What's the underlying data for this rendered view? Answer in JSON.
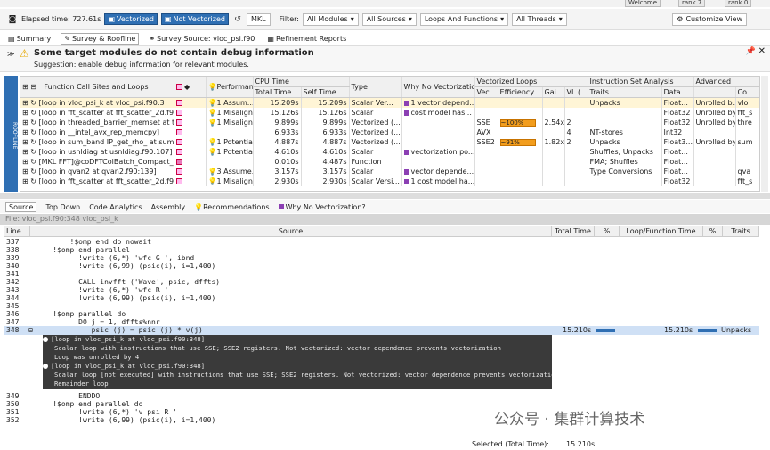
{
  "window_tabs": [
    "Welcome",
    "rank.7",
    "rank.0"
  ],
  "toolbar": {
    "elapsed": "Elapsed time: 727.61s",
    "vectorized": "Vectorized",
    "not_vectorized": "Not Vectorized",
    "mkl": "MKL",
    "filter_label": "Filter:",
    "all_modules": "All Modules",
    "all_sources": "All Sources",
    "loops_functions": "Loops And Functions",
    "all_threads": "All Threads",
    "customize": "Customize View"
  },
  "view_tabs": [
    "Summary",
    "Survey & Roofline",
    "Survey Source: vloc_psi.f90",
    "Refinement Reports"
  ],
  "warning": {
    "title": "Some target modules do not contain debug information",
    "suggestion": "Suggestion: enable debug information for relevant modules."
  },
  "roofline_label": "ROOFLINE",
  "grid": {
    "col1": "Function Call Sites and Loops",
    "group_headers": [
      "Performance Issues",
      "CPU Time",
      "Type",
      "Why No Vectorization?",
      "Vectorized Loops",
      "Instruction Set Analysis",
      "Advanced"
    ],
    "subheaders": [
      "Total Time",
      "Self Time",
      "Vec...",
      "Efficiency",
      "Gai...",
      "VL (...",
      "Traits",
      "Data ...",
      "Co"
    ],
    "rows": [
      [
        "[loop in vloc_psi_k at vloc_psi.f90:3",
        "1 Assum...",
        "15.209s",
        "15.209s",
        "Scalar Ver...",
        "1 vector depend...",
        "",
        "",
        "",
        "",
        "Unpacks",
        "Float...",
        "Unrolled b...",
        "vlo"
      ],
      [
        "[loop in fft_scatter at fft_scatter_2d.f9",
        "1 Misalign...",
        "15.126s",
        "15.126s",
        "Scalar",
        "cost model has...",
        "",
        "",
        "",
        "",
        "",
        "Float32",
        "Unrolled by 2",
        "fft_s"
      ],
      [
        "[loop in threaded_barrier_memset at th",
        "1 Misalign...",
        "9.899s",
        "9.899s",
        "Vectorized (...",
        "",
        "SSE",
        "~100%",
        "2.54x",
        "2",
        "",
        "Float32",
        "Unrolled by 4",
        "thre"
      ],
      [
        "[loop in __intel_avx_rep_memcpy]",
        "",
        "6.933s",
        "6.933s",
        "Vectorized (...",
        "",
        "AVX",
        "",
        "",
        "4",
        "NT-stores",
        "Int32",
        "",
        ""
      ],
      [
        "[loop in sum_band IP_get_rho_ at sum_",
        "1 Potentia...",
        "4.887s",
        "4.887s",
        "Vectorized (...",
        "",
        "SSE2",
        "~91%",
        "1.82x",
        "2",
        "Unpacks",
        "Float3...",
        "Unrolled by 4",
        "sum"
      ],
      [
        "[loop in usnldiag at usnldiag.f90:107]",
        "1 Potentia...",
        "4.610s",
        "4.610s",
        "Scalar",
        "vectorization po...",
        "",
        "",
        "",
        "",
        "Shuffles; Unpacks",
        "Float...",
        "",
        ""
      ],
      [
        "[MKL FFT]@coDFTColBatch_Compact_Fw",
        "",
        "0.010s",
        "4.487s",
        "Function",
        "",
        "",
        "",
        "",
        "",
        "FMA; Shuffles",
        "Float...",
        "",
        ""
      ],
      [
        "[loop in qvan2 at qvan2.f90:139]",
        "3 Assume...",
        "3.157s",
        "3.157s",
        "Scalar",
        "vector depende...",
        "",
        "",
        "",
        "",
        "Type Conversions",
        "Float...",
        "",
        "qva"
      ],
      [
        "[loop in fft_scatter at fft_scatter_2d.f90",
        "1 Misalign...",
        "2.930s",
        "2.930s",
        "Scalar Versi...",
        "1 cost model ha...",
        "",
        "",
        "",
        "",
        "",
        "Float32",
        "",
        "fft_s"
      ]
    ]
  },
  "bottom_tabs": [
    "Source",
    "Top Down",
    "Code Analytics",
    "Assembly",
    "Recommendations",
    "Why No Vectorization?"
  ],
  "file_label": "File: vloc_psi.f90:348 vloc_psi_k",
  "source_headers": [
    "Line",
    "Source",
    "Total Time",
    "%",
    "Loop/Function Time",
    "%",
    "Traits"
  ],
  "source_lines": [
    [
      "337",
      "        !$omp end do nowait"
    ],
    [
      "338",
      "    !$omp end parallel"
    ],
    [
      "339",
      "          !write (6,*) 'wfc G ', ibnd"
    ],
    [
      "340",
      "          !write (6,99) (psic(i), i=1,400)"
    ],
    [
      "341",
      ""
    ],
    [
      "342",
      "          CALL invfft ('Wave', psic, dffts)"
    ],
    [
      "343",
      "          !write (6,*) 'wfc R '"
    ],
    [
      "344",
      "          !write (6,99) (psic(i), i=1,400)"
    ],
    [
      "345",
      ""
    ],
    [
      "346",
      "    !$omp parallel do"
    ],
    [
      "347",
      "          DO j = 1, dffts%nnr"
    ]
  ],
  "selected_line": {
    "ln": "348",
    "code": "             psic (j) = psic (j) * v(j)",
    "total": "15.210s",
    "loop_time": "15.210s",
    "traits": "Unpacks"
  },
  "annotations": [
    "[loop in vloc_psi_k at vloc_psi.f90:348]",
    "   Scalar loop with instructions that use SSE; SSE2 registers. Not vectorized: vector dependence prevents vectorization",
    "   Loop was unrolled by 4",
    "[loop in vloc_psi_k at vloc_psi.f90:348]",
    "   Scalar loop [not executed] with instructions that use SSE; SSE2 registers. Not vectorized: vector dependence prevents vectorizatio",
    "   Remainder loop"
  ],
  "after_lines": [
    [
      "349",
      "          ENDDO"
    ],
    [
      "350",
      "    !$omp end parallel do"
    ],
    [
      "351",
      "          !write (6,*) 'v psi R '"
    ],
    [
      "352",
      "          !write (6,99) (psic(i), i=1,400)"
    ]
  ],
  "footer": {
    "label": "Selected (Total Time):",
    "value": "15.210s"
  },
  "watermark": "公众号 · 集群计算技术"
}
